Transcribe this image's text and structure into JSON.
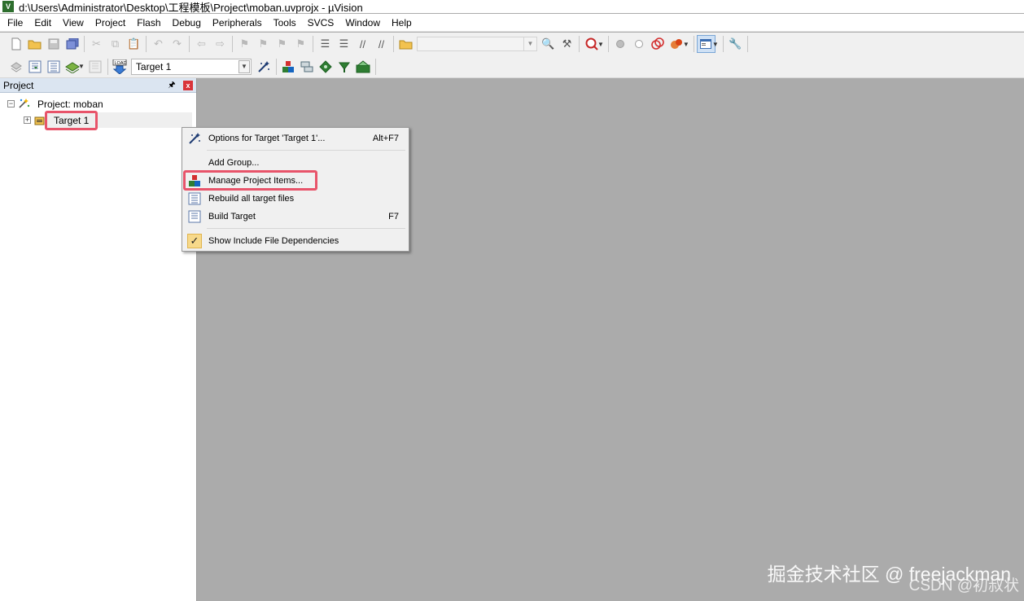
{
  "window": {
    "title": "d:\\Users\\Administrator\\Desktop\\工程模板\\Project\\moban.uvprojx - µVision",
    "app_icon": "V"
  },
  "menu": [
    "File",
    "Edit",
    "View",
    "Project",
    "Flash",
    "Debug",
    "Peripherals",
    "Tools",
    "SVCS",
    "Window",
    "Help"
  ],
  "toolbar": {
    "target_select": "Target 1",
    "load_label": "LOAD"
  },
  "project_panel": {
    "title": "Project",
    "pin_glyph": "🖈",
    "close_glyph": "x",
    "tree": [
      {
        "label": "Project: moban",
        "expander": "−"
      },
      {
        "label": "Target 1",
        "expander": "+"
      }
    ]
  },
  "context_menu": {
    "items": [
      {
        "label": "Options for Target 'Target 1'...",
        "shortcut": "Alt+F7",
        "icon": "magic-wand-icon"
      },
      {
        "label": "Add Group...",
        "shortcut": "",
        "icon": ""
      },
      {
        "label": "Manage Project Items...",
        "shortcut": "",
        "icon": "manage-items-icon"
      },
      {
        "label": "Rebuild all target files",
        "shortcut": "",
        "icon": "rebuild-icon"
      },
      {
        "label": "Build Target",
        "shortcut": "F7",
        "icon": "build-icon"
      },
      {
        "label": "Show Include File Dependencies",
        "shortcut": "",
        "icon": "checkmark-icon",
        "checked": true
      }
    ],
    "check_glyph": "✓"
  },
  "watermark": {
    "line1": "掘金技术社区 @ freejackman",
    "line2": "CSDN @初叔状"
  },
  "colors": {
    "highlight_box": "#e8546a",
    "workspace": "#ababab",
    "panel_header": "#dbe5f1"
  }
}
